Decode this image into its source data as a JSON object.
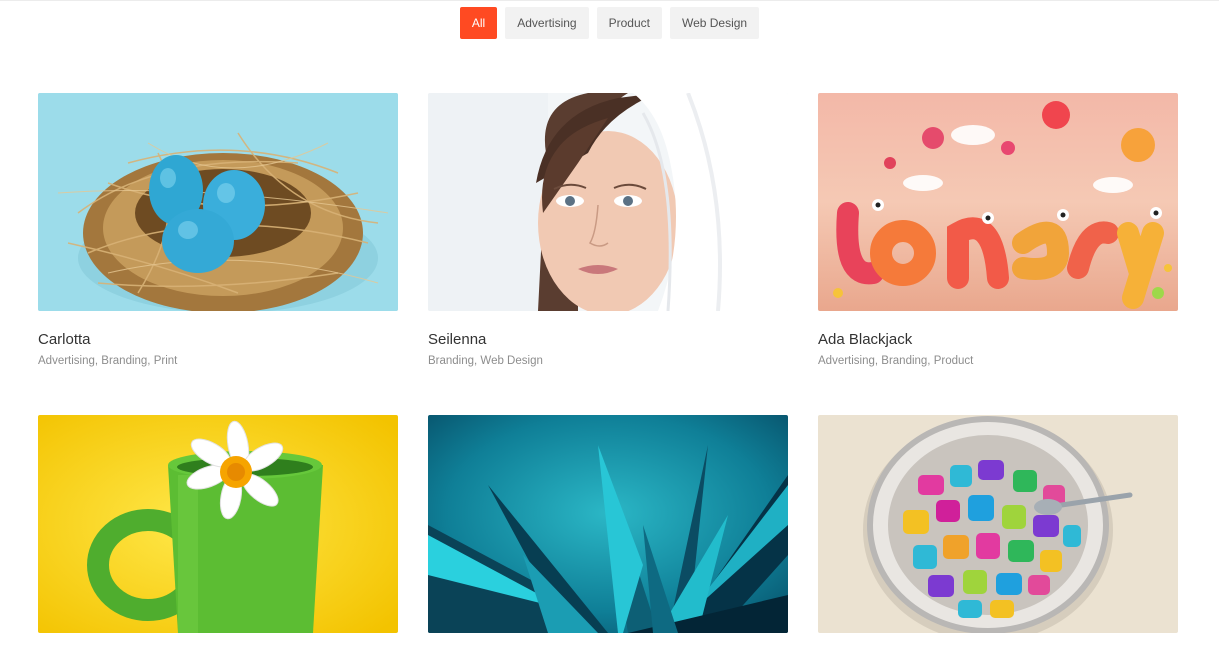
{
  "filters": {
    "items": [
      {
        "label": "All",
        "active": true
      },
      {
        "label": "Advertising",
        "active": false
      },
      {
        "label": "Product",
        "active": false
      },
      {
        "label": "Web Design",
        "active": false
      }
    ]
  },
  "accent_color": "#ff4a22",
  "portfolio": {
    "items": [
      {
        "title": "Carlotta",
        "categories": "Advertising, Branding, Print",
        "image": "blue-eggs-nest"
      },
      {
        "title": "Seilenna",
        "categories": "Branding, Web Design",
        "image": "woman-white-veil"
      },
      {
        "title": "Ada Blackjack",
        "categories": "Advertising, Branding, Product",
        "image": "3d-letters-balloons"
      },
      {
        "title": "",
        "categories": "",
        "image": "green-mug-flower"
      },
      {
        "title": "",
        "categories": "",
        "image": "teal-crystal-spikes"
      },
      {
        "title": "",
        "categories": "",
        "image": "jar-colorful-letters"
      }
    ]
  }
}
